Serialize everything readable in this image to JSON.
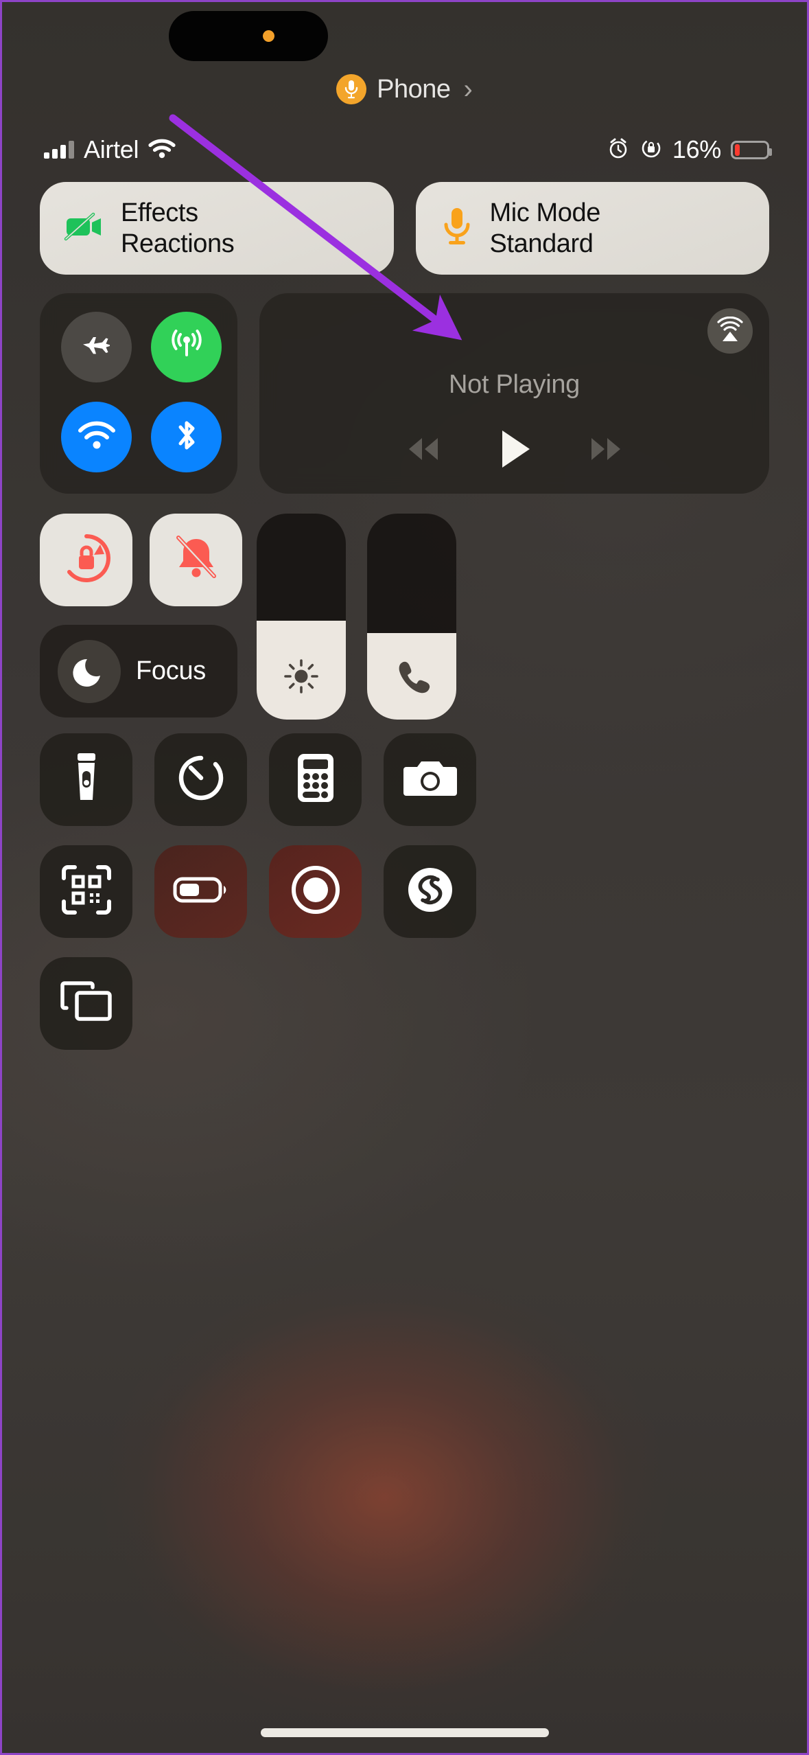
{
  "device": {
    "screen_title": "iOS Control Center",
    "home_indicator": "home-indicator"
  },
  "call_pill": {
    "icon": "microphone-icon",
    "label": "Phone",
    "chevron": "›",
    "badge_color": "#f3a52b"
  },
  "status_bar": {
    "carrier": "Airtel",
    "signal_icon": "cellular-bars-icon",
    "wifi_icon": "wifi-icon",
    "alarm_icon": "alarm-clock-icon",
    "rotation_lock_icon": "rotation-lock-icon",
    "battery_percent": "16%",
    "battery_level": 16,
    "battery_color": "#fb3b30"
  },
  "top_tiles": [
    {
      "name": "effects",
      "icon": "video-off-icon",
      "icon_color": "#1ec25a",
      "title": "Effects",
      "subtitle": "Reactions"
    },
    {
      "name": "mic-mode",
      "icon": "microphone-icon",
      "icon_color": "#f9a21b",
      "title": "Mic Mode",
      "subtitle": "Standard"
    }
  ],
  "connectivity": {
    "toggles": [
      {
        "name": "airplane-mode",
        "icon": "airplane-icon",
        "state": "off",
        "color": "#4c4945"
      },
      {
        "name": "cellular-data",
        "icon": "cellular-antenna-icon",
        "state": "on",
        "color": "#31d158"
      },
      {
        "name": "wifi",
        "icon": "wifi-icon",
        "state": "on",
        "color": "#0a84ff"
      },
      {
        "name": "bluetooth",
        "icon": "bluetooth-icon",
        "state": "on",
        "color": "#0a84ff"
      }
    ]
  },
  "media": {
    "airplay_icon": "airplay-audio-icon",
    "status": "Not Playing",
    "controls": [
      {
        "name": "previous-track",
        "icon": "rewind-icon"
      },
      {
        "name": "play",
        "icon": "play-icon"
      },
      {
        "name": "next-track",
        "icon": "fast-forward-icon"
      }
    ]
  },
  "toggles_mid": [
    {
      "name": "rotation-lock",
      "icon": "rotation-lock-icon",
      "state": "on",
      "icon_color": "#fb5b52"
    },
    {
      "name": "silent-mode",
      "icon": "bell-slash-icon",
      "state": "on",
      "icon_color": "#fb5b52"
    }
  ],
  "focus": {
    "name": "focus",
    "icon": "moon-icon",
    "label": "Focus"
  },
  "sliders": [
    {
      "name": "brightness",
      "icon": "brightness-sun-icon",
      "value": 48
    },
    {
      "name": "volume",
      "icon": "phone-handset-icon",
      "value": 42
    }
  ],
  "icon_grid": [
    [
      {
        "name": "flashlight",
        "icon": "flashlight-icon",
        "tint": "dark"
      },
      {
        "name": "timer",
        "icon": "timer-icon",
        "tint": "dark"
      },
      {
        "name": "calculator",
        "icon": "calculator-icon",
        "tint": "dark"
      },
      {
        "name": "camera",
        "icon": "camera-icon",
        "tint": "dark"
      }
    ],
    [
      {
        "name": "code-scanner",
        "icon": "qr-code-scan-icon",
        "tint": "dark"
      },
      {
        "name": "low-power-mode",
        "icon": "battery-low-power-icon",
        "tint": "warm"
      },
      {
        "name": "screen-recording",
        "icon": "record-circle-icon",
        "tint": "warm2"
      },
      {
        "name": "shazam-music-recognition",
        "icon": "shazam-icon",
        "tint": "dark"
      }
    ],
    [
      {
        "name": "screen-mirroring",
        "icon": "screen-mirroring-icon",
        "tint": "dark"
      }
    ]
  ],
  "annotation": {
    "type": "arrow",
    "color": "#9b30e0",
    "points_to": "mic-mode-tile"
  }
}
